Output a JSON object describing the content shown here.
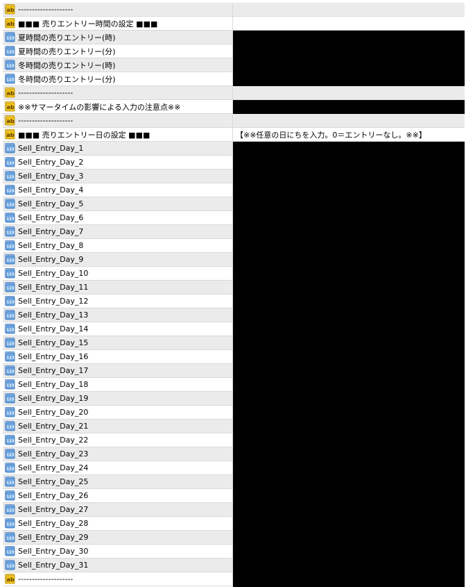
{
  "rows": [
    {
      "type": "ab",
      "name": "--------------------",
      "value": "",
      "shade": true
    },
    {
      "type": "ab",
      "name": "■■■ 売りエントリー時間の設定 ■■■",
      "value": "",
      "shade": false
    },
    {
      "type": "123",
      "name": "夏時間の売りエントリー(時)",
      "value": "",
      "shade": true
    },
    {
      "type": "123",
      "name": "夏時間の売りエントリー(分)",
      "value": "",
      "shade": false
    },
    {
      "type": "123",
      "name": "冬時間の売りエントリー(時)",
      "value": "",
      "shade": true
    },
    {
      "type": "123",
      "name": "冬時間の売りエントリー(分)",
      "value": "",
      "shade": false
    },
    {
      "type": "ab",
      "name": "--------------------",
      "value": "",
      "shade": true
    },
    {
      "type": "ab",
      "name": "※※サマータイムの影響による入力の注意点※※",
      "value": "",
      "shade": false
    },
    {
      "type": "ab",
      "name": "--------------------",
      "value": "",
      "shade": true
    },
    {
      "type": "ab",
      "name": "■■■ 売りエントリー日の設定 ■■■",
      "value": "【※※任意の日にちを入力。0＝エントリーなし。※※】",
      "shade": false
    },
    {
      "type": "123",
      "name": "Sell_Entry_Day_1",
      "value": "",
      "shade": true
    },
    {
      "type": "123",
      "name": "Sell_Entry_Day_2",
      "value": "",
      "shade": false
    },
    {
      "type": "123",
      "name": "Sell_Entry_Day_3",
      "value": "",
      "shade": true
    },
    {
      "type": "123",
      "name": "Sell_Entry_Day_4",
      "value": "",
      "shade": false
    },
    {
      "type": "123",
      "name": "Sell_Entry_Day_5",
      "value": "",
      "shade": true
    },
    {
      "type": "123",
      "name": "Sell_Entry_Day_6",
      "value": "",
      "shade": false
    },
    {
      "type": "123",
      "name": "Sell_Entry_Day_7",
      "value": "",
      "shade": true
    },
    {
      "type": "123",
      "name": "Sell_Entry_Day_8",
      "value": "",
      "shade": false
    },
    {
      "type": "123",
      "name": "Sell_Entry_Day_9",
      "value": "",
      "shade": true
    },
    {
      "type": "123",
      "name": "Sell_Entry_Day_10",
      "value": "",
      "shade": false
    },
    {
      "type": "123",
      "name": "Sell_Entry_Day_11",
      "value": "",
      "shade": true
    },
    {
      "type": "123",
      "name": "Sell_Entry_Day_12",
      "value": "",
      "shade": false
    },
    {
      "type": "123",
      "name": "Sell_Entry_Day_13",
      "value": "",
      "shade": true
    },
    {
      "type": "123",
      "name": "Sell_Entry_Day_14",
      "value": "",
      "shade": false
    },
    {
      "type": "123",
      "name": "Sell_Entry_Day_15",
      "value": "",
      "shade": true
    },
    {
      "type": "123",
      "name": "Sell_Entry_Day_16",
      "value": "",
      "shade": false
    },
    {
      "type": "123",
      "name": "Sell_Entry_Day_17",
      "value": "",
      "shade": true
    },
    {
      "type": "123",
      "name": "Sell_Entry_Day_18",
      "value": "",
      "shade": false
    },
    {
      "type": "123",
      "name": "Sell_Entry_Day_19",
      "value": "",
      "shade": true
    },
    {
      "type": "123",
      "name": "Sell_Entry_Day_20",
      "value": "",
      "shade": false
    },
    {
      "type": "123",
      "name": "Sell_Entry_Day_21",
      "value": "",
      "shade": true
    },
    {
      "type": "123",
      "name": "Sell_Entry_Day_22",
      "value": "",
      "shade": false
    },
    {
      "type": "123",
      "name": "Sell_Entry_Day_23",
      "value": "",
      "shade": true
    },
    {
      "type": "123",
      "name": "Sell_Entry_Day_24",
      "value": "",
      "shade": false
    },
    {
      "type": "123",
      "name": "Sell_Entry_Day_25",
      "value": "",
      "shade": true
    },
    {
      "type": "123",
      "name": "Sell_Entry_Day_26",
      "value": "",
      "shade": false
    },
    {
      "type": "123",
      "name": "Sell_Entry_Day_27",
      "value": "",
      "shade": true
    },
    {
      "type": "123",
      "name": "Sell_Entry_Day_28",
      "value": "",
      "shade": false
    },
    {
      "type": "123",
      "name": "Sell_Entry_Day_29",
      "value": "",
      "shade": true
    },
    {
      "type": "123",
      "name": "Sell_Entry_Day_30",
      "value": "",
      "shade": false
    },
    {
      "type": "123",
      "name": "Sell_Entry_Day_31",
      "value": "",
      "shade": true
    },
    {
      "type": "ab",
      "name": "--------------------",
      "value": "",
      "shade": false
    }
  ],
  "icons": {
    "ab": {
      "semantic": "string-type-icon",
      "glyph": "ab",
      "color": "#f0c419"
    },
    "123": {
      "semantic": "integer-type-icon",
      "glyph": "123",
      "color": "#3c7fc4"
    }
  }
}
